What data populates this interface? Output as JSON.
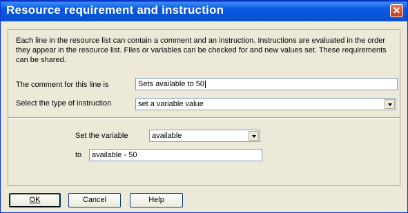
{
  "window": {
    "title": "Resource requirement and instruction"
  },
  "description": "Each line in the resource list can contain a comment and an instruction.  Instructions are evaluated in the order they appear in the resource list.  Files or variables can be checked for and new values set.  These requirements can be shared.",
  "comment": {
    "label": "The comment for this line is",
    "value": "Sets available to 50"
  },
  "instruction_type": {
    "label": "Select the type of instruction",
    "selected": "set a variable value"
  },
  "variable": {
    "label": "Set the variable",
    "selected": "available"
  },
  "to": {
    "label": "to",
    "value": "available - 50"
  },
  "buttons": {
    "ok": "OK",
    "cancel": "Cancel",
    "help": "Help"
  },
  "icons": {
    "close": "close-icon"
  }
}
